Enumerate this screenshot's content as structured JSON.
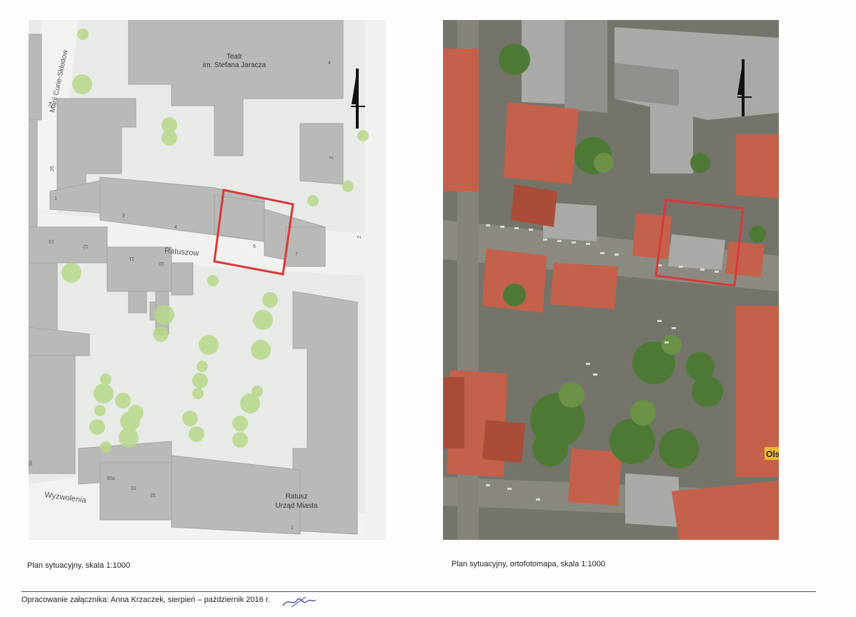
{
  "left_map": {
    "caption": "Plan sytuacyjny, skala 1:1000",
    "labels": {
      "teatr_line1": "Teatr",
      "teatr_line2": "im. Stefana Jaracza",
      "street_curie": "Marii Curie-Skłodow",
      "street_ratusz": "Ratuszow",
      "street_wyzwolenia": "Wyzwolenia",
      "ratusz_line1": "Ratusz",
      "ratusz_line2": "Urząd Miasta"
    },
    "house_numbers": [
      "24",
      "26",
      "1",
      "3",
      "4",
      "6",
      "7",
      "13",
      "12",
      "11",
      "10",
      "3",
      "4",
      "2",
      "30",
      "30a",
      "31",
      "32",
      "1"
    ]
  },
  "right_map": {
    "caption": "Plan sytuacyjny, ortofotomapa, skala 1:1000",
    "edge_label": "Ols"
  },
  "footer": {
    "text": "Opracowanie załącznika: Anna Krzaczek, sierpień – październik 2016 r."
  },
  "colors": {
    "highlight": "#d9383a",
    "building_map": "#b8b8b6",
    "tree": "#b6d98a",
    "roof_red": "#c4614a"
  }
}
